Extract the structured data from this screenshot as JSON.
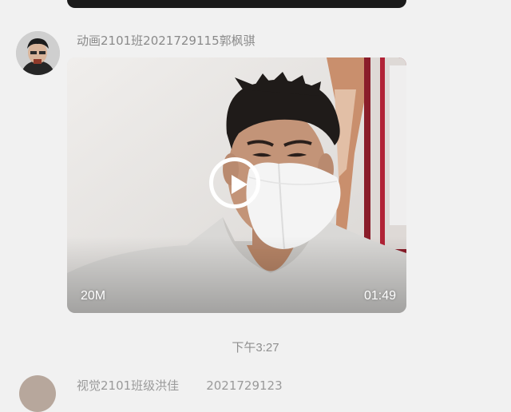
{
  "chat": {
    "message": {
      "sender": "动画2101班2021729115郭枫骐",
      "video": {
        "size": "20M",
        "duration": "01:49",
        "thumbnail": "student-selfie-wearing-white-mask",
        "play_icon": "play-circle-icon"
      }
    },
    "timestamp": "下午3:27",
    "next_message": {
      "sender_prefix": "视觉2101班级洪佳",
      "sender_suffix": "2021729123"
    }
  },
  "colors": {
    "background": "#f1f1f1",
    "sender_text": "#8a8a8a",
    "timestamp_text": "#8f8f8f",
    "video_overlay_text": "#ffffff"
  }
}
